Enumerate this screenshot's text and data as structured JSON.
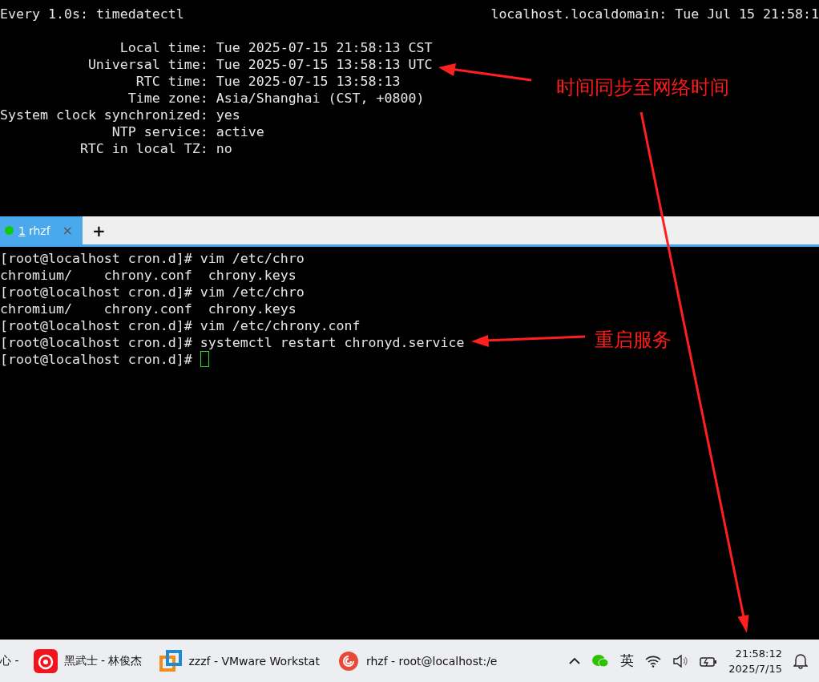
{
  "watch_header": {
    "left": "Every 1.0s: timedatectl",
    "right": "localhost.localdomain: Tue Jul 15 21:58:1"
  },
  "status_lines": [
    {
      "label": "Local time:",
      "value": "Tue 2025-07-15 21:58:13 CST"
    },
    {
      "label": "Universal time:",
      "value": "Tue 2025-07-15 13:58:13 UTC"
    },
    {
      "label": "RTC time:",
      "value": "Tue 2025-07-15 13:58:13"
    },
    {
      "label": "Time zone:",
      "value": "Asia/Shanghai (CST, +0800)"
    },
    {
      "label": "System clock synchronized:",
      "value": "yes"
    },
    {
      "label": "NTP service:",
      "value": "active"
    },
    {
      "label": "RTC in local TZ:",
      "value": "no"
    }
  ],
  "tabs": [
    {
      "number": "1",
      "label": "rhzf",
      "selected": true,
      "connected": true,
      "close": "×"
    }
  ],
  "new_tab": "+",
  "terminal_lines": [
    {
      "kind": "prompt",
      "prompt": "[root@localhost cron.d]#",
      "command": "vim /etc/chro"
    },
    {
      "kind": "output",
      "text": "chromium/    chrony.conf  chrony.keys"
    },
    {
      "kind": "prompt",
      "prompt": "[root@localhost cron.d]#",
      "command": "vim /etc/chro"
    },
    {
      "kind": "output",
      "text": "chromium/    chrony.conf  chrony.keys"
    },
    {
      "kind": "prompt",
      "prompt": "[root@localhost cron.d]#",
      "command": "vim /etc/chrony.conf"
    },
    {
      "kind": "prompt",
      "prompt": "[root@localhost cron.d]#",
      "command": "systemctl restart chronyd.service"
    },
    {
      "kind": "prompt",
      "prompt": "[root@localhost cron.d]#",
      "cursor": true
    }
  ],
  "annotations": [
    {
      "text": "时间同步至网络时间"
    },
    {
      "text": "重启服务"
    }
  ],
  "taskbar": {
    "items": [
      {
        "kind": "cut",
        "label": "心 -"
      },
      {
        "kind": "music",
        "label": "黑武士 - 林俊杰"
      },
      {
        "kind": "vmware",
        "label": "zzzf - VMware Workstat"
      },
      {
        "kind": "shell",
        "label": "rhzf - root@localhost:/e"
      }
    ],
    "input_method": "英",
    "time": "21:58:12",
    "date": "2025/7/15"
  }
}
